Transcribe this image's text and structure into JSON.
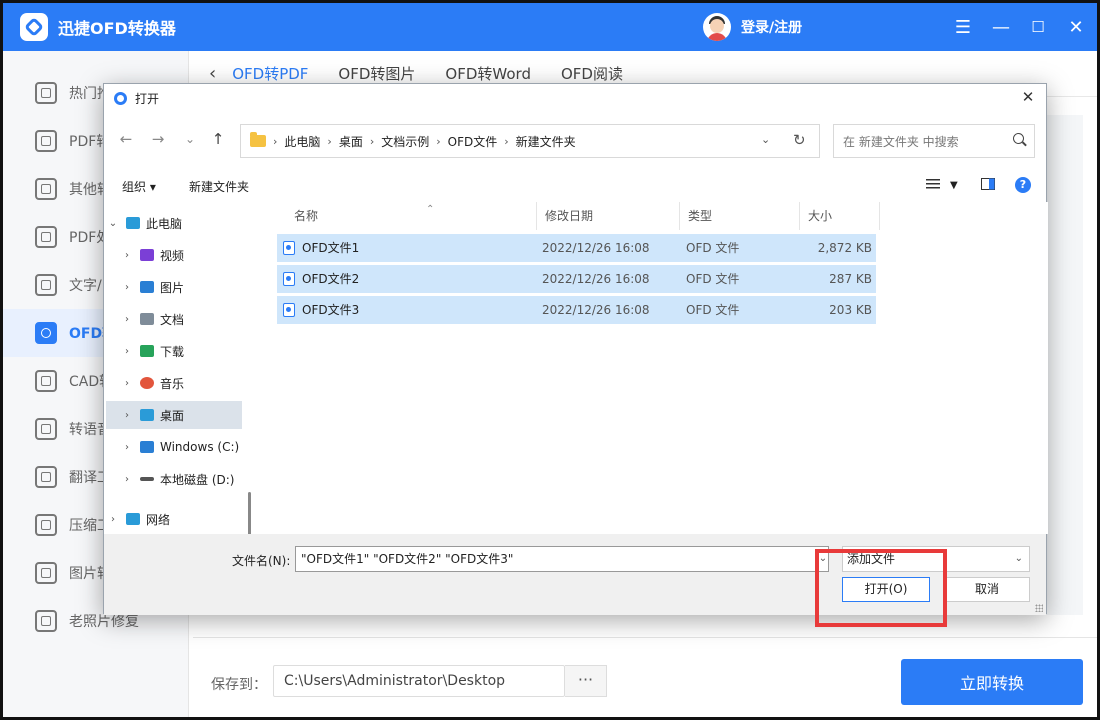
{
  "app": {
    "title": "迅捷OFD转换器",
    "login_text": "登录/注册",
    "window_controls": [
      "☰",
      "—",
      "☐",
      "✕"
    ]
  },
  "sidebar": {
    "items": [
      {
        "label": "热门推",
        "icon": "fire-icon"
      },
      {
        "label": "PDF转",
        "icon": "pdf-icon"
      },
      {
        "label": "其他转",
        "icon": "doc-icon"
      },
      {
        "label": "PDF处",
        "icon": "pdf-tools-icon"
      },
      {
        "label": "文字/",
        "icon": "text-icon"
      },
      {
        "label": "OFD转",
        "icon": "ofd-icon",
        "active": true
      },
      {
        "label": "CAD转",
        "icon": "cad-icon"
      },
      {
        "label": "转语音",
        "icon": "voice-icon"
      },
      {
        "label": "翻译工",
        "icon": "translate-icon"
      },
      {
        "label": "压缩工",
        "icon": "compress-icon"
      },
      {
        "label": "图片转",
        "icon": "image-icon"
      },
      {
        "label": "老照片修复",
        "icon": "photo-icon"
      }
    ]
  },
  "tabs": [
    {
      "label": "OFD转PDF",
      "active": true
    },
    {
      "label": "OFD转图片"
    },
    {
      "label": "OFD转Word"
    },
    {
      "label": "OFD阅读"
    }
  ],
  "bottom": {
    "save_label": "保存到：",
    "save_path": "C:\\Users\\Administrator\\Desktop",
    "browse": "···",
    "convert": "立即转换"
  },
  "dialog": {
    "title": "打开",
    "nav": {
      "back": "←",
      "forward": "→",
      "recent": "⌄",
      "up": "↑"
    },
    "breadcrumbs": [
      "此电脑",
      "桌面",
      "文档示例",
      "OFD文件",
      "新建文件夹"
    ],
    "search_placeholder": "在 新建文件夹 中搜索",
    "toolbar": {
      "organize": "组织 ▾",
      "new_folder": "新建文件夹",
      "help": "?"
    },
    "tree": [
      {
        "label": "此电脑",
        "expanded": true,
        "color": "#2a9bd8"
      },
      {
        "label": "视频",
        "color": "#7b3fd6"
      },
      {
        "label": "图片",
        "color": "#2a7fd4"
      },
      {
        "label": "文档",
        "color": "#7f8c99"
      },
      {
        "label": "下载",
        "color": "#27a35a"
      },
      {
        "label": "音乐",
        "color": "#e2553c"
      },
      {
        "label": "桌面",
        "selected": true,
        "color": "#2a9bd8"
      },
      {
        "label": "Windows (C:)",
        "color": "#2a7fd4"
      },
      {
        "label": "本地磁盘 (D:)",
        "color": "#555555"
      },
      {
        "label": "网络",
        "color": "#2a9bd8"
      }
    ],
    "columns": {
      "name": "名称",
      "modified": "修改日期",
      "type": "类型",
      "size": "大小"
    },
    "files": [
      {
        "name": "OFD文件1",
        "modified": "2022/12/26 16:08",
        "type": "OFD 文件",
        "size": "2,872 KB"
      },
      {
        "name": "OFD文件2",
        "modified": "2022/12/26 16:08",
        "type": "OFD 文件",
        "size": "287 KB"
      },
      {
        "name": "OFD文件3",
        "modified": "2022/12/26 16:08",
        "type": "OFD 文件",
        "size": "203 KB"
      }
    ],
    "filename_label": "文件名(N):",
    "filename_value": "\"OFD文件1\" \"OFD文件2\" \"OFD文件3\"",
    "filetype": "添加文件",
    "open": "打开(O)",
    "cancel": "取消"
  },
  "colors": {
    "accent": "#2b7cf6",
    "highlight": "#e83a3a",
    "selection": "#cfe6fb"
  }
}
